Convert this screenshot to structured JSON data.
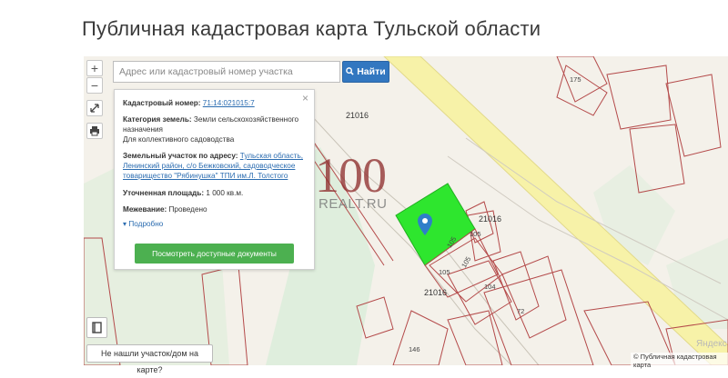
{
  "page_title": "Публичная кадастровая карта Тульской области",
  "controls": {
    "zoom_in": "+",
    "zoom_out": "−"
  },
  "search": {
    "placeholder": "Адрес или кадастровый номер участка",
    "button_label": "Найти"
  },
  "card": {
    "close": "×",
    "cadastral_label": "Кадастровый номер:",
    "cadastral_value": "71:14:021015:7",
    "category_label": "Категория земель:",
    "category_value": "Земли сельскохозяйственного назначения",
    "use_value": "Для коллективного садоводства",
    "address_label": "Земельный участок по адресу:",
    "address_value": "Тульская область, Ленинский район, с/о Бежковский, садоводческое товарищество \"Рябинушка\" ТПИ им.Л. Толстого",
    "area_label": "Уточненная площадь:",
    "area_value": "1 000 кв.м.",
    "survey_label": "Межевание:",
    "survey_value": "Проведено",
    "more_label": "Подробно",
    "docs_button": "Посмотреть доступные документы"
  },
  "watermark": {
    "number": "100",
    "site": "REALT.RU"
  },
  "map_labels": {
    "road_1": "21016",
    "road_2": "21016",
    "road_3": "21016",
    "plot_175": "175",
    "plot_105a": "105",
    "plot_105b": "105",
    "plot_105c": "105",
    "plot_105d": "105",
    "plot_104": "104",
    "plot_72": "72",
    "plot_146": "146",
    "yandex": "Яндекс"
  },
  "not_found_button": "Не нашли участок/дом на карте?",
  "attribution": "© Публичная кадастровая карта",
  "colors": {
    "selected_plot": "#2ee62e",
    "parcel_border": "#b44a4a",
    "road": "#f5f0a0",
    "search_button": "#3277c0",
    "docs_button": "#4cb050",
    "marker": "#2f7ec9"
  },
  "icons": [
    "fullscreen-icon",
    "print-icon",
    "bookmark-icon",
    "location-marker-icon",
    "search-icon",
    "caret-down-icon"
  ]
}
